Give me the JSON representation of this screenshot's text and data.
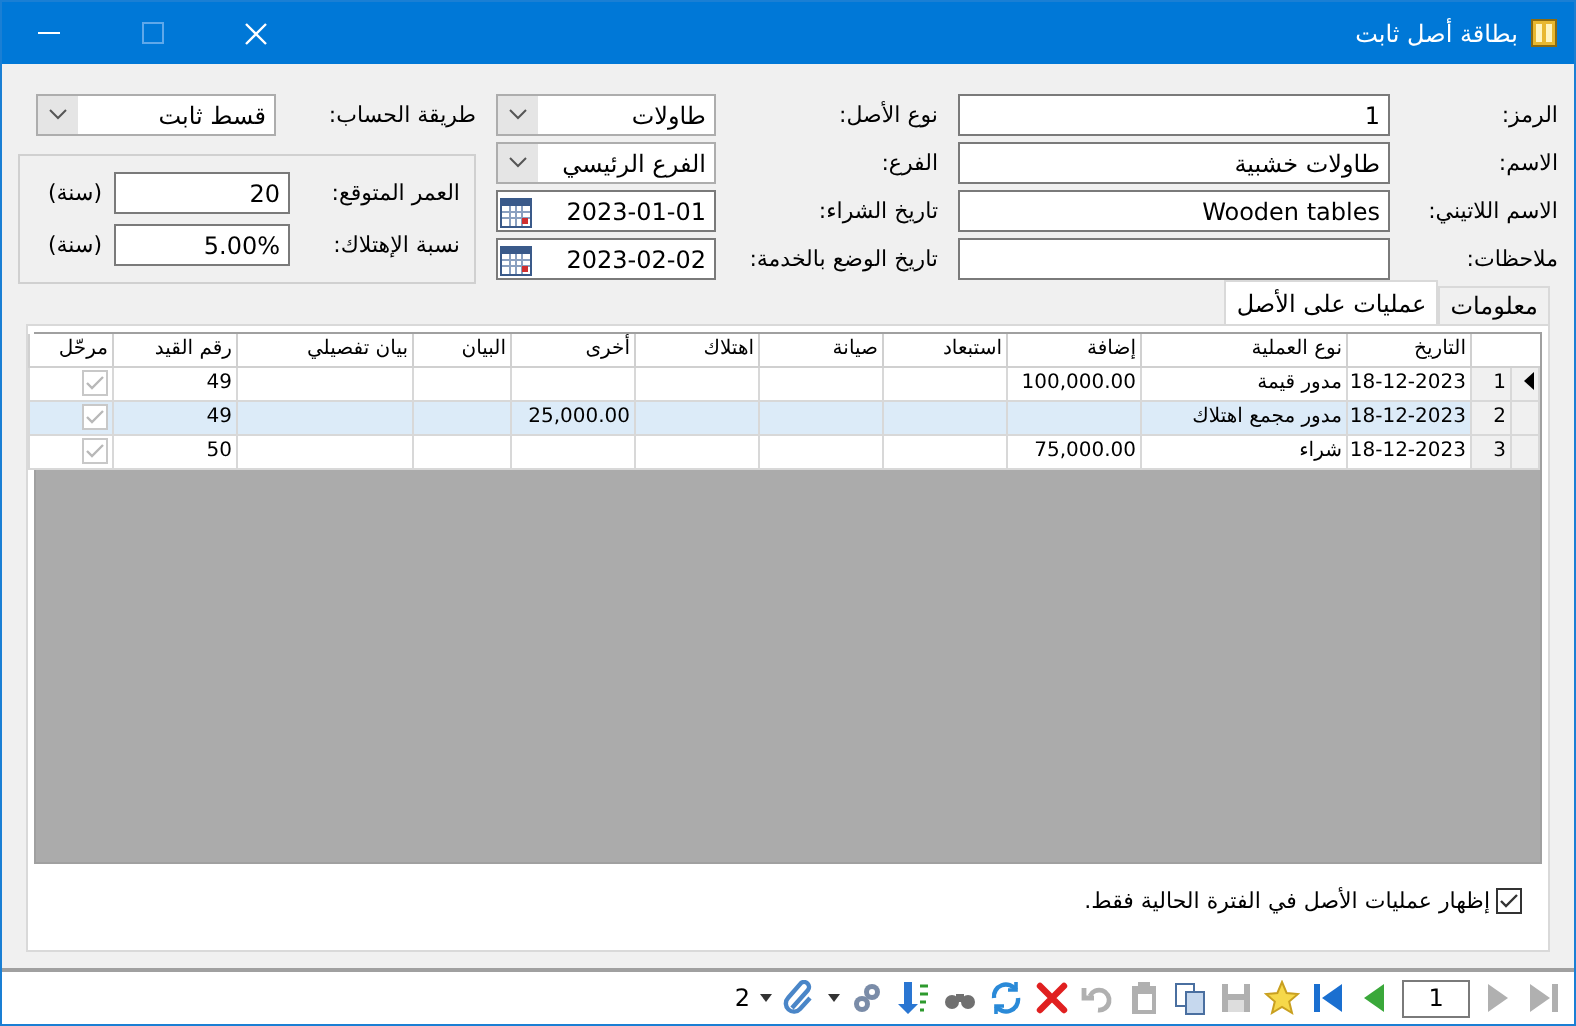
{
  "window": {
    "title": "بطاقة أصل ثابت"
  },
  "main_fields": [
    {
      "label": "الرمز:",
      "value": "1",
      "kind": "text"
    },
    {
      "label": "الاسم:",
      "value": "طاولات خشبية",
      "kind": "text"
    },
    {
      "label": "الاسم اللاتيني:",
      "value": "Wooden tables",
      "kind": "text"
    },
    {
      "label": "ملاحظات:",
      "kind": "text"
    }
  ],
  "asset_fields": [
    {
      "label": "نوع الأصل:",
      "value": "طاولات",
      "kind": "select"
    },
    {
      "label": "الفرع:",
      "value": "الفرع الرئيسي",
      "kind": "select"
    },
    {
      "label": "تاريخ الشراء:",
      "value": "2023-01-01",
      "kind": "date"
    },
    {
      "label": "تاريخ الوضع بالخدمة:",
      "value": "2023-02-02",
      "kind": "date"
    }
  ],
  "method": {
    "label": "طريقة الحساب:",
    "value": "قسط ثابت"
  },
  "depreciation": [
    {
      "label": "العمر المتوقع:",
      "value": "20",
      "unit": "(سنة)"
    },
    {
      "label": "نسبة الإهتلاك:",
      "value": "5.00%",
      "unit": "(سنة)"
    }
  ],
  "tabs": [
    {
      "label": "معلومات",
      "selected": false
    },
    {
      "label": "عمليات على الأصل",
      "selected": true
    }
  ],
  "table": {
    "columns": [
      "التاريخ",
      "نوع العملية",
      "إضافة",
      "استبعاد",
      "صيانة",
      "اهتلاك",
      "أخرى",
      "البيان",
      "بيان تفصيلي",
      "رقم القيد",
      "مرحّل"
    ],
    "rows": [
      {
        "number": "1",
        "current": true,
        "highlighted": false,
        "cells": [
          "18-12-2023",
          "مدور قيمة",
          "100,000.00",
          "",
          "",
          "",
          "",
          "",
          "",
          "49"
        ],
        "posted": true
      },
      {
        "number": "2",
        "current": false,
        "highlighted": true,
        "cells": [
          "18-12-2023",
          "مدور مجمع اهتلاك",
          "",
          "",
          "",
          "",
          "25,000.00",
          "",
          "",
          "49"
        ],
        "posted": true
      },
      {
        "number": "3",
        "current": false,
        "highlighted": false,
        "cells": [
          "18-12-2023",
          "شراء",
          "75,000.00",
          "",
          "",
          "",
          "",
          "",
          "",
          "50"
        ],
        "posted": true
      }
    ]
  },
  "current_period_only": {
    "label": "إظهار عمليات الأصل في الفترة الحالية فقط.",
    "checked": true
  },
  "toolbar": [
    {
      "kind": "last",
      "disabled": true
    },
    {
      "kind": "next",
      "disabled": true
    },
    {
      "kind": "page",
      "text": "1"
    },
    {
      "kind": "prev",
      "disabled": false
    },
    {
      "kind": "first",
      "disabled": false
    },
    {
      "kind": "star",
      "disabled": false
    },
    {
      "kind": "save",
      "disabled": true
    },
    {
      "kind": "copy",
      "disabled": false
    },
    {
      "kind": "paste",
      "disabled": true
    },
    {
      "kind": "undo",
      "disabled": true
    },
    {
      "kind": "delete",
      "disabled": false
    },
    {
      "kind": "refresh",
      "disabled": false
    },
    {
      "kind": "binoculars",
      "disabled": false
    },
    {
      "kind": "sort",
      "disabled": false
    },
    {
      "kind": "gears",
      "disabled": false
    },
    {
      "kind": "caret",
      "disabled": false
    },
    {
      "kind": "attach",
      "disabled": false
    },
    {
      "kind": "caret",
      "disabled": false
    },
    {
      "kind": "count",
      "text": "2"
    }
  ]
}
